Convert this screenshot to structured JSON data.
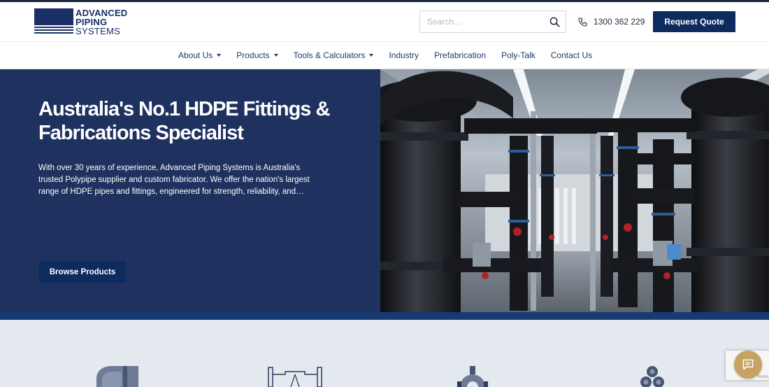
{
  "brand": {
    "line1": "ADVANCED",
    "line2": "PIPING",
    "line3": "SYSTEMS",
    "color": "#1a2f66"
  },
  "header": {
    "search_placeholder": "Search...",
    "phone": "1300 362 229",
    "quote_label": "Request Quote"
  },
  "nav": {
    "items": [
      {
        "label": "About Us",
        "dropdown": true
      },
      {
        "label": "Products",
        "dropdown": true
      },
      {
        "label": "Tools & Calculators",
        "dropdown": true
      },
      {
        "label": "Industry",
        "dropdown": false
      },
      {
        "label": "Prefabrication",
        "dropdown": false
      },
      {
        "label": "Poly-Talk",
        "dropdown": false
      },
      {
        "label": "Contact Us",
        "dropdown": false
      }
    ]
  },
  "hero": {
    "title": "Australia's No.1 HDPE Fittings & Fabrications Specialist",
    "description": "With over 30 years of experience, Advanced Piping Systems is Australia's trusted Polypipe supplier and custom fabricator. We offer the nation's largest range of HDPE pipes and fittings, engineered for strength, reliability, and…",
    "cta_label": "Browse Products",
    "image_alt": "Industrial HDPE pipe installation with black pipes, blue flanges, and red valves"
  },
  "colors": {
    "navy": "#1f325f",
    "button": "#0d2b5e",
    "accent_bar": "#183a73",
    "section_bg": "#e4e9ef",
    "chat_gold": "#c6a263"
  },
  "icons": {
    "search": "search-icon",
    "phone": "phone-icon",
    "chat": "chat-bubble-icon",
    "categories": [
      "elbow-fitting-icon",
      "flange-fitting-icon",
      "valve-fitting-icon",
      "pipe-bundle-icon"
    ]
  },
  "recaptcha": {
    "label": "Terms"
  }
}
